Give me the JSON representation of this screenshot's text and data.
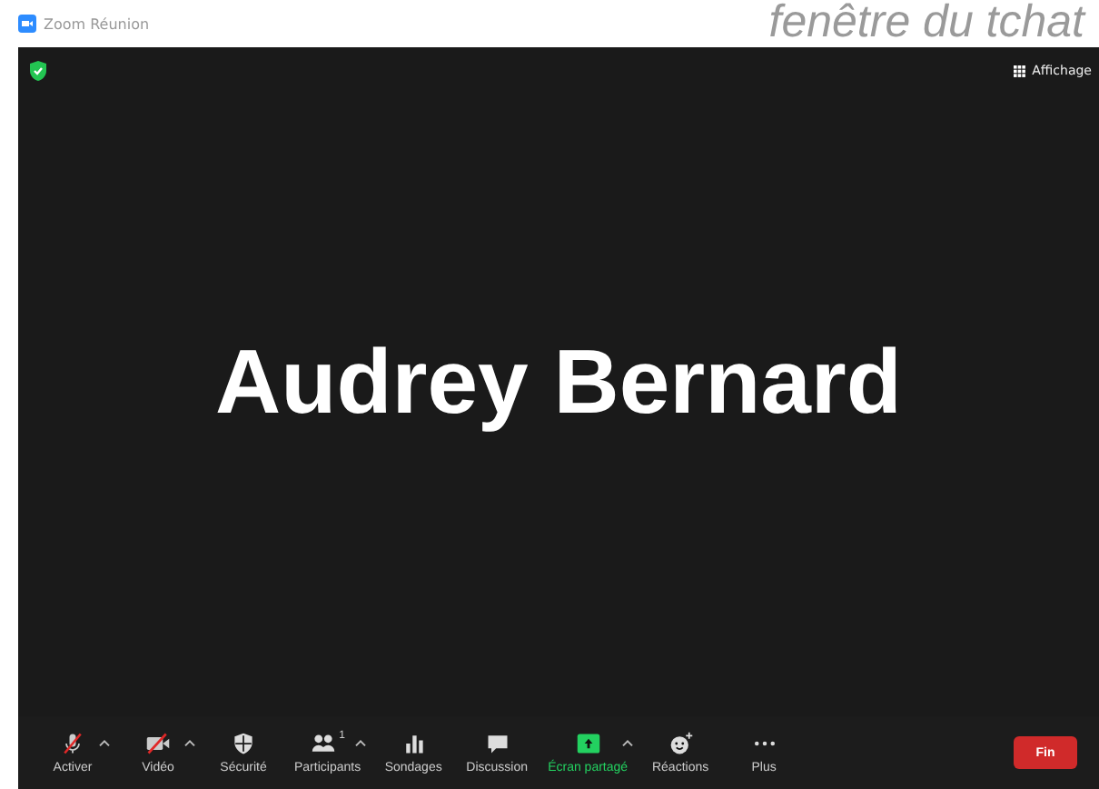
{
  "annotation": "fenêtre du tchat",
  "window": {
    "title": "Zoom Réunion"
  },
  "view_button": "Affichage",
  "speaker_name": "Audrey Bernard",
  "toolbar": [
    {
      "kind": "mic",
      "label": "Activer",
      "off": true,
      "caret": true
    },
    {
      "kind": "video",
      "label": "Vidéo",
      "off": true,
      "caret": true
    },
    {
      "kind": "security",
      "label": "Sécurité",
      "caret": false
    },
    {
      "kind": "participants",
      "label": "Participants",
      "count": "1",
      "caret": true
    },
    {
      "kind": "polls",
      "label": "Sondages",
      "caret": false
    },
    {
      "kind": "chat",
      "label": "Discussion",
      "caret": false
    },
    {
      "kind": "share",
      "label": "Écran partagé",
      "selected": true,
      "caret": true
    },
    {
      "kind": "reactions",
      "label": "Réactions",
      "caret": false
    },
    {
      "kind": "more",
      "label": "Plus",
      "caret": false
    }
  ],
  "end_button": "Fin"
}
